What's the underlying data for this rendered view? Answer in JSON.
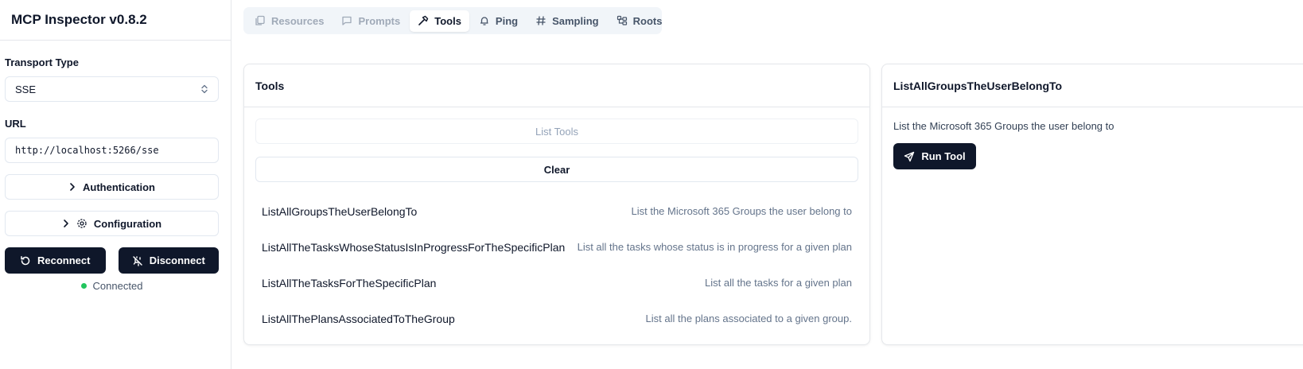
{
  "app": {
    "title": "MCP Inspector v0.8.2"
  },
  "sidebar": {
    "transport_label": "Transport Type",
    "transport_value": "SSE",
    "url_label": "URL",
    "url_value": "http://localhost:5266/sse",
    "authentication_label": "Authentication",
    "configuration_label": "Configuration",
    "reconnect_label": "Reconnect",
    "disconnect_label": "Disconnect",
    "status_text": "Connected",
    "status_color": "#22c55e"
  },
  "tabs": [
    {
      "label": "Resources",
      "icon": "files-icon",
      "state": "disabled"
    },
    {
      "label": "Prompts",
      "icon": "message-square-icon",
      "state": "disabled"
    },
    {
      "label": "Tools",
      "icon": "hammer-icon",
      "state": "active"
    },
    {
      "label": "Ping",
      "icon": "bell-icon",
      "state": "normal"
    },
    {
      "label": "Sampling",
      "icon": "hash-icon",
      "state": "normal"
    },
    {
      "label": "Roots",
      "icon": "folder-tree-icon",
      "state": "normal"
    }
  ],
  "tools_panel": {
    "title": "Tools",
    "list_tools_label": "List Tools",
    "clear_label": "Clear",
    "tools": [
      {
        "name": "ListAllGroupsTheUserBelongTo",
        "description": "List the Microsoft 365 Groups the user belong to"
      },
      {
        "name": "ListAllTheTasksWhoseStatusIsInProgressForTheSpecificPlan",
        "description": "List all the tasks whose status is in progress for a given plan"
      },
      {
        "name": "ListAllTheTasksForTheSpecificPlan",
        "description": "List all the tasks for a given plan"
      },
      {
        "name": "ListAllThePlansAssociatedToTheGroup",
        "description": "List all the plans associated to a given group."
      }
    ]
  },
  "detail_panel": {
    "title": "ListAllGroupsTheUserBelongTo",
    "description": "List the Microsoft 365 Groups the user belong to",
    "run_label": "Run Tool"
  },
  "colors": {
    "primary_dark": "#0f172a",
    "border": "#e5e7eb",
    "muted": "#64748b"
  }
}
